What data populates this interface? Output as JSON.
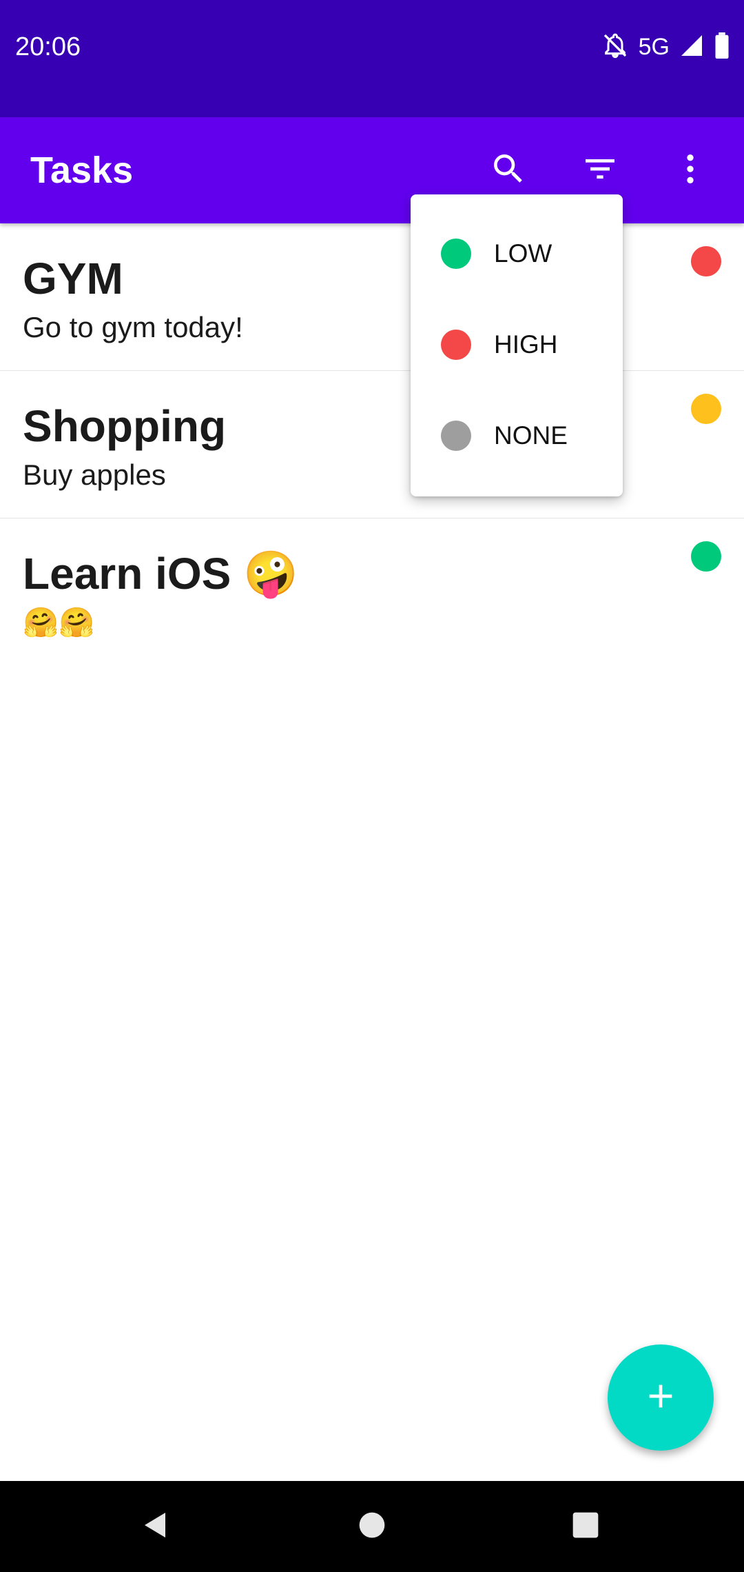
{
  "status_bar": {
    "time": "20:06",
    "network": "5G",
    "icons": [
      "bell-off-icon",
      "signal-icon",
      "battery-icon"
    ]
  },
  "app_bar": {
    "title": "Tasks",
    "actions": [
      "search-icon",
      "filter-icon",
      "more-vert-icon"
    ]
  },
  "tasks": [
    {
      "title": "GYM",
      "description": "Go to gym today!",
      "priority_color": "#f44848"
    },
    {
      "title": "Shopping",
      "description": "Buy apples",
      "priority_color": "#fdc01d"
    },
    {
      "title": "Learn iOS 🤪",
      "description": "🤗🤗",
      "priority_color": "#00c97b"
    }
  ],
  "priority_menu": {
    "items": [
      {
        "label": "LOW",
        "color": "#00c97b"
      },
      {
        "label": "HIGH",
        "color": "#f44848"
      },
      {
        "label": "NONE",
        "color": "#9e9e9e"
      }
    ]
  },
  "fab": {
    "icon": "add-icon",
    "color": "#03dac5"
  },
  "nav_bar": {
    "buttons": [
      "back-icon",
      "home-icon",
      "recents-icon"
    ]
  },
  "colors": {
    "status_bar": "#3700b3",
    "app_bar": "#6200ee"
  }
}
